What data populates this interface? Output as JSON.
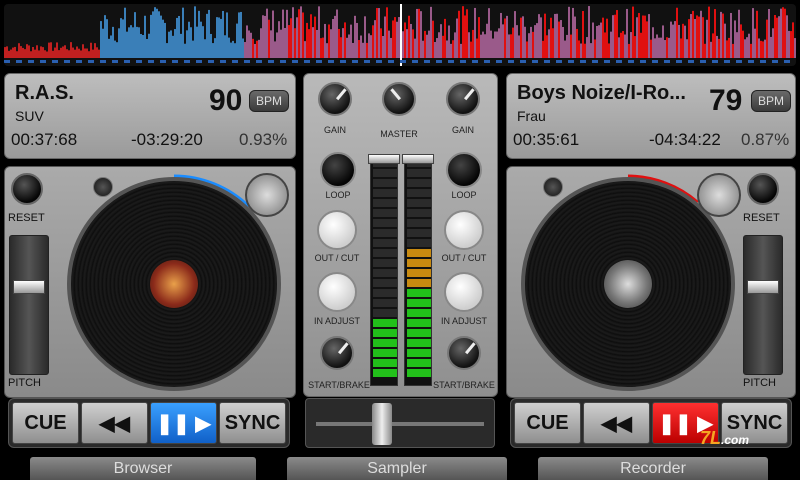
{
  "deck_left": {
    "title": "R.A.S.",
    "artist": "SUV",
    "bpm": "90",
    "bpm_button": "BPM",
    "elapsed": "00:37:68",
    "remaining": "-03:29:20",
    "pitch": "0.93%",
    "reset_label": "RESET",
    "pitch_label": "PITCH",
    "transport": {
      "cue": "CUE",
      "rewind": "◀◀",
      "play": "❚❚ ▶",
      "sync": "SYNC"
    }
  },
  "deck_right": {
    "title": "Boys Noize/I-Ro...",
    "artist": "Frau",
    "bpm": "79",
    "bpm_button": "BPM",
    "elapsed": "00:35:61",
    "remaining": "-04:34:22",
    "pitch": "0.87%",
    "reset_label": "RESET",
    "pitch_label": "PITCH",
    "transport": {
      "cue": "CUE",
      "rewind": "◀◀",
      "play": "❚❚ ▶",
      "sync": "SYNC"
    }
  },
  "mixer": {
    "gain_left": "GAIN",
    "master": "MASTER",
    "gain_right": "GAIN",
    "loop_left": "LOOP",
    "loop_right": "LOOP",
    "outcut_left": "OUT / CUT",
    "outcut_right": "OUT / CUT",
    "inadjust_left": "IN ADJUST",
    "inadjust_right": "IN ADJUST",
    "startbrake_left": "START/BRAKE",
    "startbrake_right": "START/BRAKE",
    "vu_left_level": 0.3,
    "vu_right_level": 0.6
  },
  "tabs": {
    "browser": "Browser",
    "sampler": "Sampler",
    "recorder": "Recorder"
  },
  "watermark": {
    "brand": "7L",
    "site": ".com"
  },
  "colors": {
    "accent_blue": "#1a8cff",
    "accent_red": "#e01010"
  }
}
